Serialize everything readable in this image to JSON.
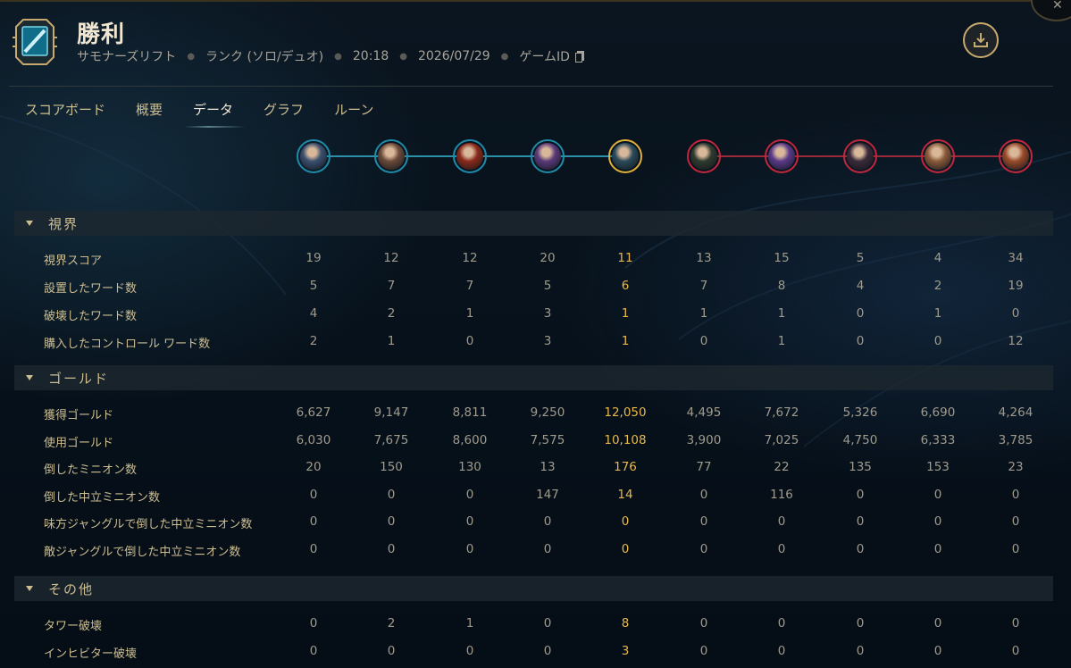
{
  "header": {
    "title": "勝利",
    "meta": {
      "map": "サモナーズリフト",
      "queue": "ランク (ソロ/デュオ)",
      "duration": "20:18",
      "date": "2026/07/29",
      "game_id_label": "ゲームID"
    }
  },
  "tabs": [
    {
      "label": "スコアボード",
      "active": false
    },
    {
      "label": "概要",
      "active": false
    },
    {
      "label": "データ",
      "active": true
    },
    {
      "label": "グラフ",
      "active": false
    },
    {
      "label": "ルーン",
      "active": false
    }
  ],
  "champions": [
    {
      "team": "blue",
      "color": "#3a4f6e"
    },
    {
      "team": "blue",
      "color": "#6b4a3a"
    },
    {
      "team": "blue",
      "color": "#8a2a1a"
    },
    {
      "team": "blue",
      "color": "#5a3a7a"
    },
    {
      "team": "blue",
      "color": "#2a4a5a",
      "me": true
    },
    {
      "team": "red",
      "color": "#2f3a2f"
    },
    {
      "team": "red",
      "color": "#5a3a8a"
    },
    {
      "team": "red",
      "color": "#3a2a3a"
    },
    {
      "team": "red",
      "color": "#8a5a3a"
    },
    {
      "team": "red",
      "color": "#9a4a2a"
    }
  ],
  "sections": [
    {
      "title": "視界",
      "rows": [
        {
          "label": "視界スコア",
          "values": [
            "19",
            "12",
            "12",
            "20",
            "11",
            "13",
            "15",
            "5",
            "4",
            "34"
          ]
        },
        {
          "label": "設置したワード数",
          "values": [
            "5",
            "7",
            "7",
            "5",
            "6",
            "7",
            "8",
            "4",
            "2",
            "19"
          ]
        },
        {
          "label": "破壊したワード数",
          "values": [
            "4",
            "2",
            "1",
            "3",
            "1",
            "1",
            "1",
            "0",
            "1",
            "0"
          ]
        },
        {
          "label": "購入したコントロール ワード数",
          "values": [
            "2",
            "1",
            "0",
            "3",
            "1",
            "0",
            "1",
            "0",
            "0",
            "12"
          ]
        }
      ]
    },
    {
      "title": "ゴールド",
      "rows": [
        {
          "label": "獲得ゴールド",
          "values": [
            "6,627",
            "9,147",
            "8,811",
            "9,250",
            "12,050",
            "4,495",
            "7,672",
            "5,326",
            "6,690",
            "4,264"
          ]
        },
        {
          "label": "使用ゴールド",
          "values": [
            "6,030",
            "7,675",
            "8,600",
            "7,575",
            "10,108",
            "3,900",
            "7,025",
            "4,750",
            "6,333",
            "3,785"
          ]
        },
        {
          "label": "倒したミニオン数",
          "values": [
            "20",
            "150",
            "130",
            "13",
            "176",
            "77",
            "22",
            "135",
            "153",
            "23"
          ]
        },
        {
          "label": "倒した中立ミニオン数",
          "values": [
            "0",
            "0",
            "0",
            "147",
            "14",
            "0",
            "116",
            "0",
            "0",
            "0"
          ]
        },
        {
          "label": "味方ジャングルで倒した中立ミニオン数",
          "values": [
            "0",
            "0",
            "0",
            "0",
            "0",
            "0",
            "0",
            "0",
            "0",
            "0"
          ]
        },
        {
          "label": "敵ジャングルで倒した中立ミニオン数",
          "values": [
            "0",
            "0",
            "0",
            "0",
            "0",
            "0",
            "0",
            "0",
            "0",
            "0"
          ]
        }
      ]
    },
    {
      "title": "その他",
      "rows": [
        {
          "label": "タワー破壊",
          "values": [
            "0",
            "2",
            "1",
            "0",
            "8",
            "0",
            "0",
            "0",
            "0",
            "0"
          ]
        },
        {
          "label": "インヒビター破壊",
          "values": [
            "0",
            "0",
            "0",
            "0",
            "3",
            "0",
            "0",
            "0",
            "0",
            "0"
          ]
        }
      ]
    }
  ],
  "colors": {
    "accent_gold": "#c8aa6e",
    "highlight": "#e8b84a",
    "blue_team": "#1f8ba8",
    "red_team": "#c2263c"
  },
  "icons": {
    "logo": "crest-icon",
    "download": "download-icon",
    "copy": "copy-icon",
    "close": "close-icon",
    "collapse": "caret-down-icon"
  }
}
